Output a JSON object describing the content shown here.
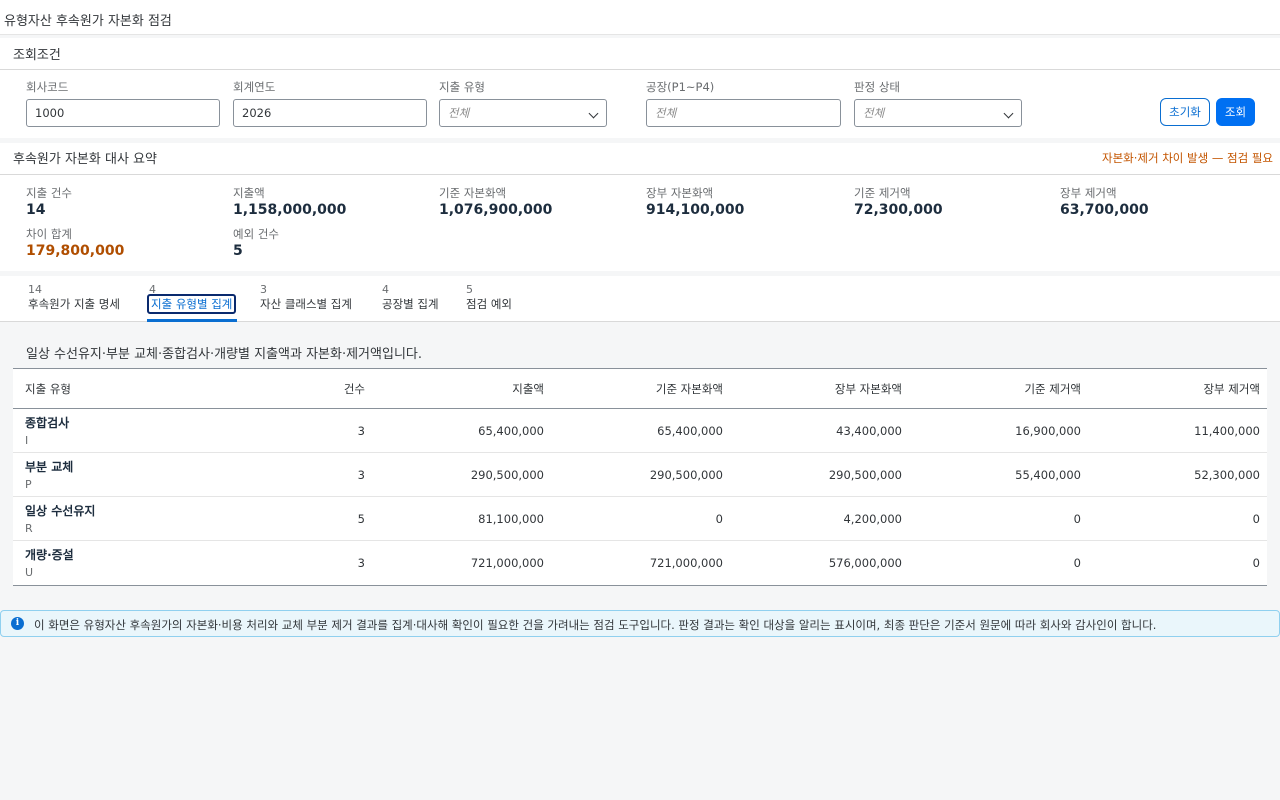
{
  "page": {
    "title": "유형자산 후속원가 자본화 점검"
  },
  "filters": {
    "title": "조회조건",
    "company_code": {
      "label": "회사코드",
      "value": "1000"
    },
    "fiscal_year": {
      "label": "회계연도",
      "value": "2026"
    },
    "expense_type": {
      "label": "지출 유형",
      "value": "전체"
    },
    "plant": {
      "label": "공장(P1~P4)",
      "placeholder": "전체"
    },
    "judgment_status": {
      "label": "판정 상태",
      "value": "전체"
    },
    "reset_label": "초기화",
    "search_label": "조회"
  },
  "summary": {
    "title": "후속원가 자본화 대사 요약",
    "warning": "자본화·제거 차이 발생 — 점검 필요",
    "kpis": [
      {
        "label": "지출 건수",
        "value": "14"
      },
      {
        "label": "지출액",
        "value": "1,158,000,000"
      },
      {
        "label": "기준 자본화액",
        "value": "1,076,900,000"
      },
      {
        "label": "장부 자본화액",
        "value": "914,100,000"
      },
      {
        "label": "기준 제거액",
        "value": "72,300,000"
      },
      {
        "label": "장부 제거액",
        "value": "63,700,000"
      },
      {
        "label": "차이 합계",
        "value": "179,800,000"
      },
      {
        "label": "예외 건수",
        "value": "5"
      }
    ]
  },
  "tabs": [
    {
      "count": "14",
      "label": "후속원가 지출 명세"
    },
    {
      "count": "4",
      "label": "지출 유형별 집계"
    },
    {
      "count": "3",
      "label": "자산 클래스별 집계"
    },
    {
      "count": "4",
      "label": "공장별 집계"
    },
    {
      "count": "5",
      "label": "점검 예외"
    }
  ],
  "selected_tab": "지출 유형별 집계",
  "table": {
    "description": "일상 수선유지·부분 교체·종합검사·개량별 지출액과 자본화·제거액입니다.",
    "columns": [
      "지출 유형",
      "건수",
      "지출액",
      "기준 자본화액",
      "장부 자본화액",
      "기준 제거액",
      "장부 제거액"
    ],
    "rows": [
      {
        "name": "종합검사",
        "code": "I",
        "count": "3",
        "expense": "65,400,000",
        "std_cap": "65,400,000",
        "book_cap": "43,400,000",
        "std_rem": "16,900,000",
        "book_rem": "11,400,000"
      },
      {
        "name": "부분 교체",
        "code": "P",
        "count": "3",
        "expense": "290,500,000",
        "std_cap": "290,500,000",
        "book_cap": "290,500,000",
        "std_rem": "55,400,000",
        "book_rem": "52,300,000"
      },
      {
        "name": "일상 수선유지",
        "code": "R",
        "count": "5",
        "expense": "81,100,000",
        "std_cap": "0",
        "book_cap": "4,200,000",
        "std_rem": "0",
        "book_rem": "0"
      },
      {
        "name": "개량·증설",
        "code": "U",
        "count": "3",
        "expense": "721,000,000",
        "std_cap": "721,000,000",
        "book_cap": "576,000,000",
        "std_rem": "0",
        "book_rem": "0"
      }
    ]
  },
  "info": {
    "icon": "info-icon",
    "text": "이 화면은 유형자산 후속원가의 자본화·비용 처리와 교체 부분 제거 결과를 집계·대사해 확인이 필요한 건을 가려내는 점검 도구입니다. 판정 결과는 확인 대상을 알리는 표시이며, 최종 판단은 기준서 원문에 따라 회사와 감사인이 합니다."
  },
  "colors": {
    "accent": "#0a6ed1",
    "primary_button": "#0070f2",
    "warning": "#c35500"
  }
}
